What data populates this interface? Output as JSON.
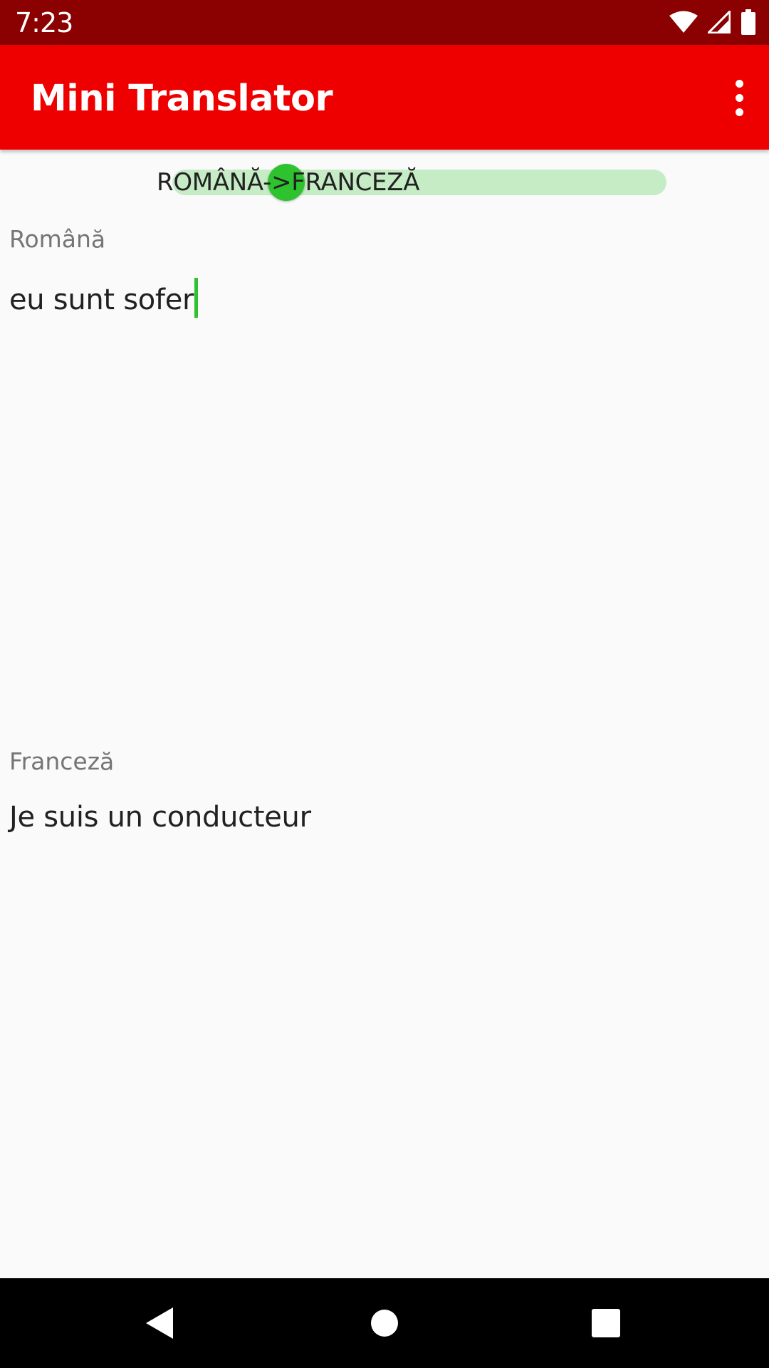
{
  "status_bar": {
    "time": "7:23",
    "icons": [
      "wifi-icon",
      "signal-icon",
      "battery-icon"
    ]
  },
  "app_bar": {
    "title": "Mini Translator",
    "menu_icon": "overflow-menu-icon"
  },
  "direction_switch": {
    "label": "ROMÂNĂ->FRANCEZĂ",
    "checked": false
  },
  "source": {
    "label": "Română",
    "value": "eu sunt sofer"
  },
  "target": {
    "label": "Franceză",
    "value": "Je suis un conducteur"
  },
  "nav_bar": {
    "icons": [
      "back-icon",
      "home-icon",
      "recents-icon"
    ]
  },
  "colors": {
    "status_bar": "#8b0000",
    "app_bar": "#ee0000",
    "accent": "#2ec22e",
    "switch_track": "#c6ecc6"
  }
}
